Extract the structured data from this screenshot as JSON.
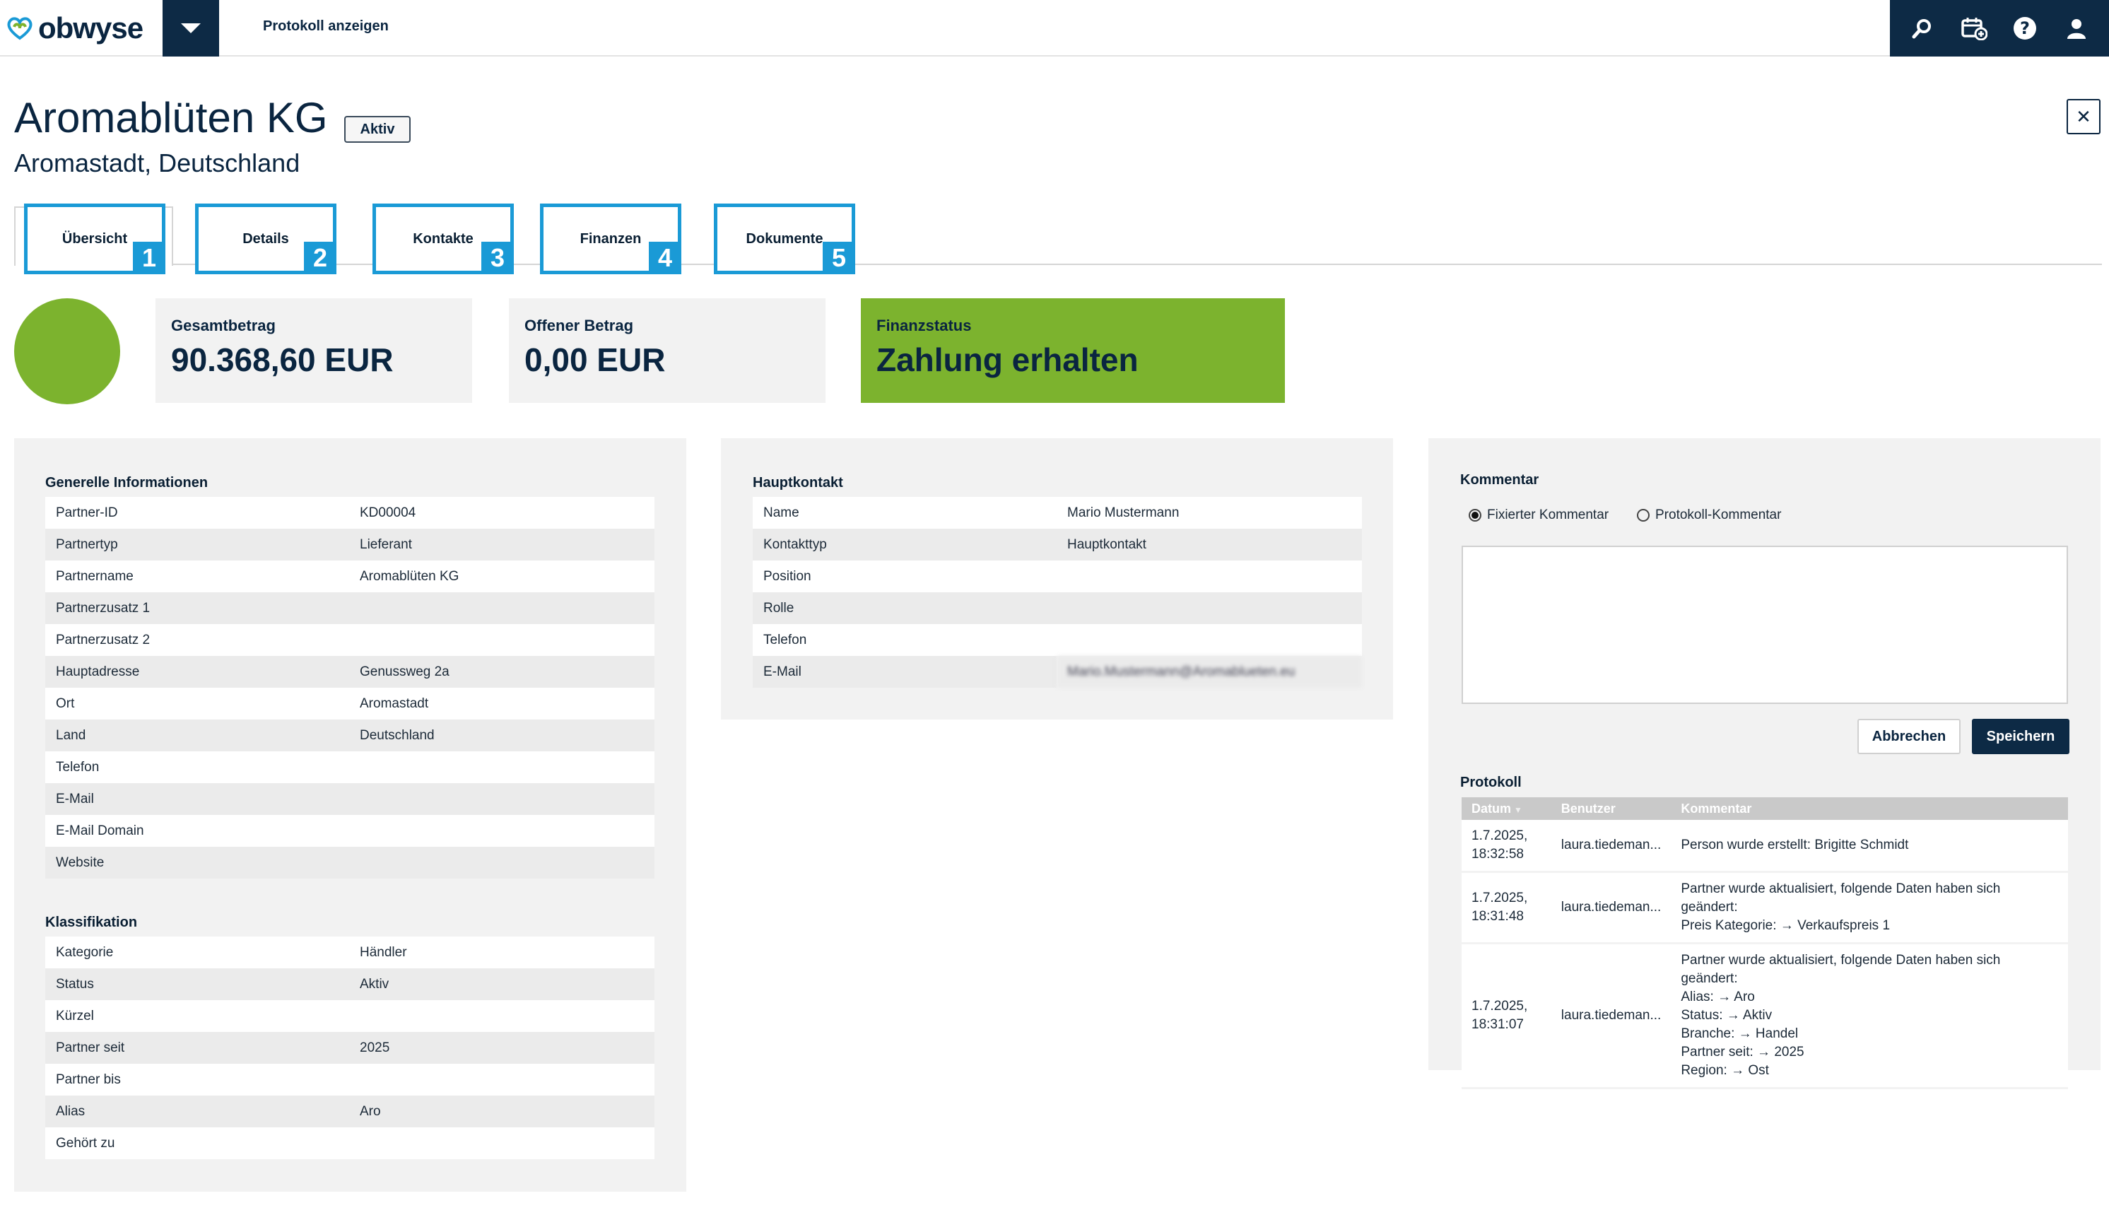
{
  "app": {
    "brand": "obwyse",
    "top_link": "Protokoll anzeigen"
  },
  "header": {
    "title": "Aromablüten KG",
    "status": "Aktiv",
    "subtitle": "Aromastadt, Deutschland",
    "close": "✕"
  },
  "tabs": [
    {
      "label": "Übersicht",
      "num": "1"
    },
    {
      "label": "Details",
      "num": "2"
    },
    {
      "label": "Kontakte",
      "num": "3"
    },
    {
      "label": "Finanzen",
      "num": "4"
    },
    {
      "label": "Dokumente",
      "num": "5"
    }
  ],
  "kpis": {
    "total": {
      "label": "Gesamtbetrag",
      "value": "90.368,60 EUR"
    },
    "open": {
      "label": "Offener Betrag",
      "value": "0,00 EUR"
    },
    "status": {
      "label": "Finanzstatus",
      "value": "Zahlung erhalten"
    }
  },
  "general": {
    "title": "Generelle Informationen",
    "rows": [
      [
        "Partner-ID",
        "KD00004"
      ],
      [
        "Partnertyp",
        "Lieferant"
      ],
      [
        "Partnername",
        "Aromablüten KG"
      ],
      [
        "Partnerzusatz 1",
        ""
      ],
      [
        "Partnerzusatz 2",
        ""
      ],
      [
        "Hauptadresse",
        "Genussweg 2a"
      ],
      [
        "Ort",
        "Aromastadt"
      ],
      [
        "Land",
        "Deutschland"
      ],
      [
        "Telefon",
        ""
      ],
      [
        "E-Mail",
        ""
      ],
      [
        "E-Mail Domain",
        ""
      ],
      [
        "Website",
        ""
      ]
    ]
  },
  "classification": {
    "title": "Klassifikation",
    "rows": [
      [
        "Kategorie",
        "Händler"
      ],
      [
        "Status",
        "Aktiv"
      ],
      [
        "Kürzel",
        ""
      ],
      [
        "Partner seit",
        "2025"
      ],
      [
        "Partner bis",
        ""
      ],
      [
        "Alias",
        "Aro"
      ],
      [
        "Gehört zu",
        ""
      ]
    ]
  },
  "contact": {
    "title": "Hauptkontakt",
    "rows": [
      [
        "Name",
        "Mario Mustermann"
      ],
      [
        "Kontakttyp",
        "Hauptkontakt"
      ],
      [
        "Position",
        ""
      ],
      [
        "Rolle",
        ""
      ],
      [
        "Telefon",
        ""
      ],
      [
        "E-Mail",
        "Mario.Mustermann@Aromablueten.eu"
      ]
    ]
  },
  "comment": {
    "title": "Kommentar",
    "radio_fixed": "Fixierter Kommentar",
    "radio_log": "Protokoll-Kommentar",
    "cancel": "Abbrechen",
    "save": "Speichern"
  },
  "log": {
    "title": "Protokoll",
    "headers": [
      "Datum",
      "Benutzer",
      "Kommentar"
    ],
    "rows": [
      {
        "date": "1.7.2025,\n18:32:58",
        "user": "laura.tiedeman...",
        "comment": "Person wurde erstellt: Brigitte Schmidt"
      },
      {
        "date": "1.7.2025,\n18:31:48",
        "user": "laura.tiedeman...",
        "comment": "Partner wurde aktualisiert, folgende Daten haben sich geändert:\nPreis Kategorie: → Verkaufspreis 1"
      },
      {
        "date": "1.7.2025,\n18:31:07",
        "user": "laura.tiedeman...",
        "comment": "Partner wurde aktualisiert, folgende Daten haben sich geändert:\nAlias: → Aro\nStatus: → Aktiv\nBranche: → Handel\nPartner seit: → 2025\nRegion: → Ost"
      }
    ]
  },
  "colors": {
    "accent": "#1a9ad6",
    "navy": "#0d2a45",
    "green": "#7cb32e"
  }
}
